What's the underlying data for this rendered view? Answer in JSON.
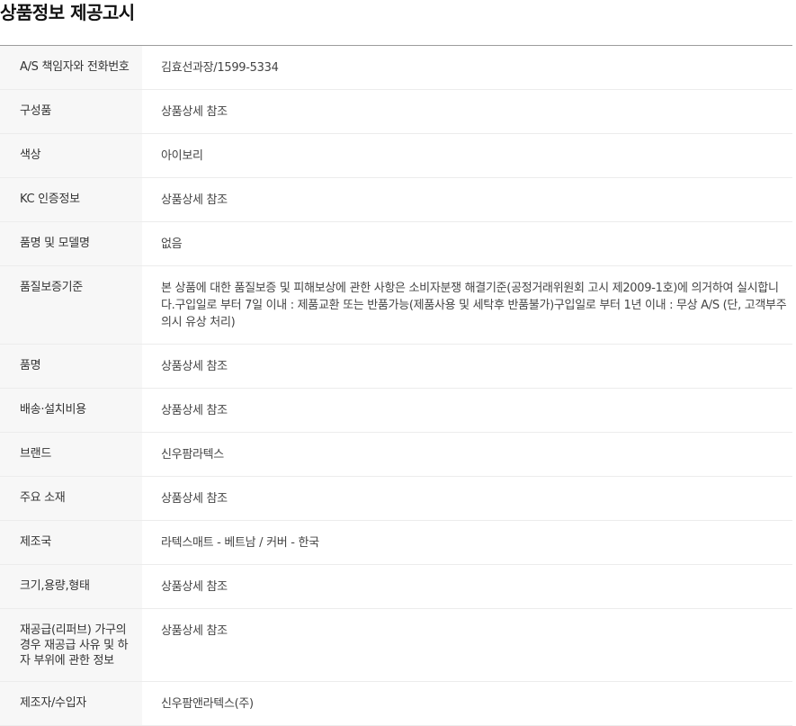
{
  "title": "상품정보 제공고시",
  "rows": [
    {
      "label": "A/S 책임자와 전화번호",
      "value": "김효선과장/1599-5334"
    },
    {
      "label": "구성품",
      "value": "상품상세 참조"
    },
    {
      "label": "색상",
      "value": "아이보리"
    },
    {
      "label": "KC 인증정보",
      "value": "상품상세 참조"
    },
    {
      "label": "품명 및 모델명",
      "value": "없음"
    },
    {
      "label": "품질보증기준",
      "value": "본 상품에 대한 품질보증 및 피해보상에 관한 사항은 소비자분쟁 해결기준(공정거래위원회 고시 제2009-1호)에 의거하여 실시합니다.구입일로 부터 7일 이내 : 제품교환 또는 반품가능(제품사용 및 세탁후 반품불가)구입일로 부터 1년 이내 : 무상 A/S (단, 고객부주의시 유상 처리)"
    },
    {
      "label": "품명",
      "value": "상품상세 참조"
    },
    {
      "label": "배송·설치비용",
      "value": "상품상세 참조"
    },
    {
      "label": "브랜드",
      "value": "신우팜라텍스"
    },
    {
      "label": "주요 소재",
      "value": "상품상세 참조"
    },
    {
      "label": "제조국",
      "value": "라텍스매트 - 베트남 / 커버 - 한국"
    },
    {
      "label": "크기,용량,형태",
      "value": "상품상세 참조"
    },
    {
      "label": "재공급(리퍼브) 가구의 경우 재공급 사유 및 하자 부위에 관한 정보",
      "value": "상품상세 참조"
    },
    {
      "label": "제조자/수입자",
      "value": "신우팜앤라텍스(주)"
    }
  ]
}
